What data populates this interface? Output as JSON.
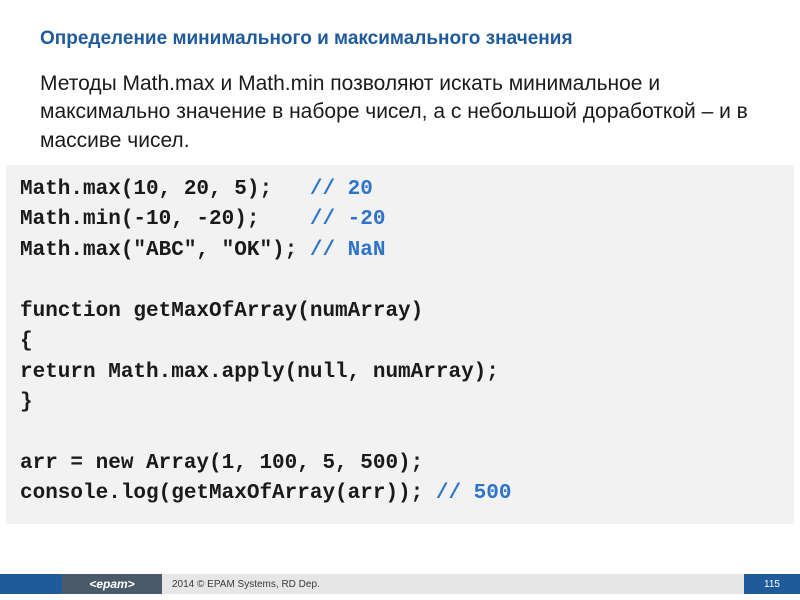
{
  "title": "Определение минимального и максимального значения",
  "body": "Методы Math.max и Math.min позволяют искать минимальное и максимально значение в наборе чисел, а с небольшой доработкой – и в массиве чисел.",
  "code": {
    "l1a": "Math.max(10, 20, 5);   ",
    "l1c": "// 20",
    "l2a": "Math.min(-10, -20);    ",
    "l2c": "// -20",
    "l3a": "Math.max(\"ABC\", \"OK\"); ",
    "l3c": "// NaN",
    "l5": "function getMaxOfArray(numArray)",
    "l6": "{",
    "l7": "return Math.max.apply(null, numArray);",
    "l8": "}",
    "l10": "arr = new Array(1, 100, 5, 500);",
    "l11a": "console.log(getMaxOfArray(arr)); ",
    "l11c": "// 500"
  },
  "footer": {
    "logo": "<epam>",
    "copyright": "2014 © EPAM Systems, RD Dep.",
    "page": "115"
  }
}
